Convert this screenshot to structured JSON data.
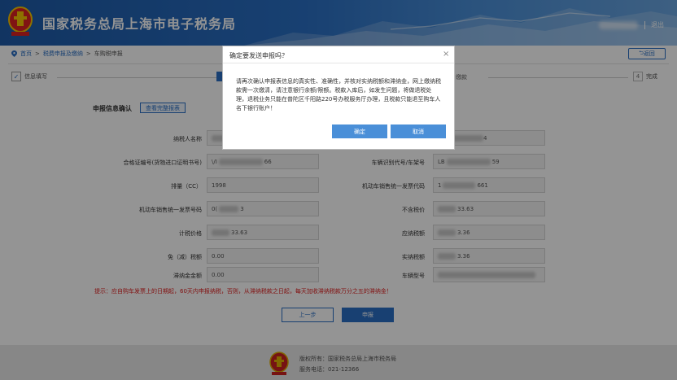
{
  "header": {
    "site_title": "国家税务总局上海市电子税务局",
    "logout": "退出",
    "emblem_icon": "tax-emblem-icon"
  },
  "breadcrumb": {
    "home": "首页",
    "level1": "税费申报及缴纳",
    "level2": "车购税申报",
    "separator": ">",
    "back": "返回"
  },
  "steps": {
    "step1": "信息填写",
    "step3": "缴款",
    "step4_num": "4",
    "step4": "完成"
  },
  "form": {
    "section_title": "申报信息确认",
    "view_report": "查看完整报表",
    "rows": [
      {
        "left_label": "纳税人名称",
        "left_value": "",
        "right_label": "",
        "right_value": "4"
      },
      {
        "left_label": "合格证编号(货物进口证明书号)",
        "left_value_prefix": "\\/I",
        "left_value_suffix": "66",
        "right_label": "车辆识别代号/车架号",
        "right_value_prefix": "LB",
        "right_value_suffix": "59"
      },
      {
        "left_label": "排量（CC）",
        "left_value": "1998",
        "right_label": "机动车销售统一发票代码",
        "right_value_prefix": "1",
        "right_value_suffix": "661"
      },
      {
        "left_label": "机动车销售统一发票号码",
        "left_value_prefix": "0(",
        "left_value_suffix": "3",
        "right_label": "不含税价",
        "right_value_suffix": "33.63"
      },
      {
        "left_label": "计税价格",
        "left_value_suffix": "33.63",
        "right_label": "应纳税额",
        "right_value_suffix": "3.36"
      },
      {
        "left_label": "免（减）税额",
        "left_value": "0.00",
        "right_label": "实纳税额",
        "right_value_suffix": "3.36"
      },
      {
        "left_label": "滞纳金金额",
        "left_value": "0.00",
        "right_label": "车辆型号",
        "right_value": ""
      }
    ],
    "tip": "提示：应自购车发票上的日期起，60天内申报纳税，否则，从滞纳税款之日起，每天加收滞纳税款万分之五的滞纳金！",
    "prev_button": "上一步",
    "submit_button": "申报"
  },
  "footer": {
    "copyright": "版权所有：国家税务总局上海市税务局",
    "phone": "服务电话：021-12366"
  },
  "modal": {
    "title": "确定要发送申报吗？",
    "close": "×",
    "body": "请再次确认申报表信息的真实性、准确性，并核对实纳税额和滞纳金，网上缴纳税款需一次缴清，请注意银行余额/限额。税款入库后，如发生问题，将做退税处理，退税业务只能在普陀区千阳路220号办税服务厅办理，且税款只能退至购车人名下银行账户！",
    "ok": "确定",
    "cancel": "取消"
  }
}
